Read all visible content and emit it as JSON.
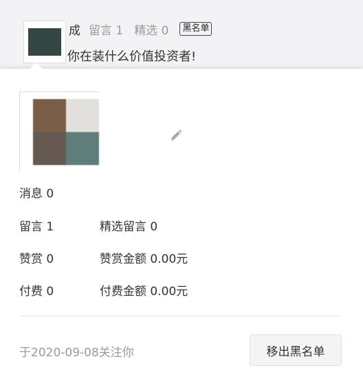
{
  "comment": {
    "author_name_partial": "成",
    "replies_label": "留言 1",
    "selected_label": "精选 0",
    "blacklist_tag": "黑名单",
    "message": "你在装什么价值投资者!"
  },
  "profile": {
    "mosaic_colors": [
      "#7a5e48",
      "#e2e0dc",
      "#655951",
      "#5f7d7a"
    ],
    "edit_icon": "pencil-icon"
  },
  "stats": {
    "messages": "消息 0",
    "comments": "留言 1",
    "selected_comments": "精选留言 0",
    "rewards": "赞赏 0",
    "reward_amount": "赞赏金额 0.00元",
    "payments": "付费 0",
    "payment_amount": "付费金额 0.00元"
  },
  "footer": {
    "follow_date": "于2020-09-08关注你",
    "remove_button": "移出黑名单"
  }
}
